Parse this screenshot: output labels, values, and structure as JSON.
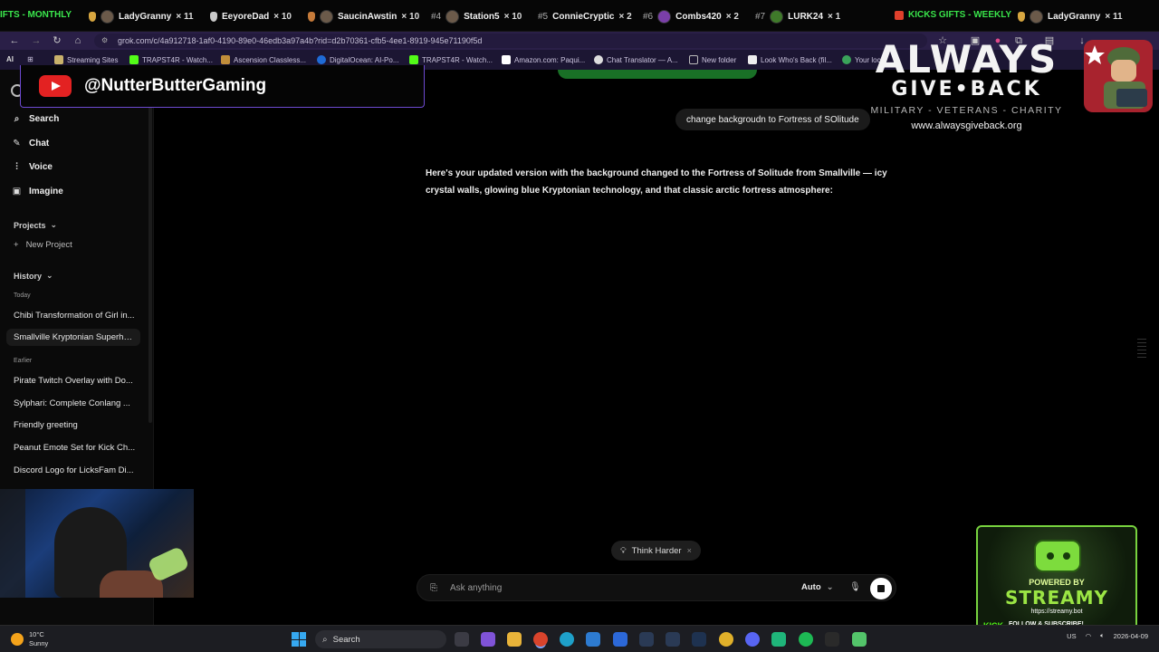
{
  "ticker": {
    "monthly_label": "IFTS - MONTHLY",
    "weekly_label": "KICKS GIFTS - WEEKLY",
    "items": [
      {
        "rank": "",
        "name": "LadyGranny",
        "count": "× 11"
      },
      {
        "rank": "",
        "name": "EeyoreDad",
        "count": "× 10"
      },
      {
        "rank": "",
        "name": "SaucinAwstin",
        "count": "× 10"
      },
      {
        "rank": "#4",
        "name": "Station5",
        "count": "× 10"
      },
      {
        "rank": "#5",
        "name": "ConnieCryptic",
        "count": "× 2"
      },
      {
        "rank": "#6",
        "name": "Combs420",
        "count": "× 2"
      },
      {
        "rank": "#7",
        "name": "LURK24",
        "count": "× 1"
      },
      {
        "rank": "",
        "name": "LadyGranny",
        "count": "× 11"
      }
    ]
  },
  "browser": {
    "url": "grok.com/c/4a912718-1af0-4190-89e0-46edb3a97a4b?rid=d2b70361-cfb5-4ee1-8919-945e71190f5d",
    "bookmarks": [
      "Streaming Sites",
      "TRAPST4R - Watch...",
      "Ascension Classless...",
      "DigitalOcean: AI-Po...",
      "TRAPST4R - Watch...",
      "Amazon.com: Paqui...",
      "Chat Translator — A...",
      "New folder",
      "Look Who's Back (fil...",
      "Your local"
    ]
  },
  "youtube": {
    "handle": "@NutterButterGaming"
  },
  "sidebar": {
    "nav": [
      {
        "label": "Search",
        "icon": "search-icon"
      },
      {
        "label": "Chat",
        "icon": "chat-icon"
      },
      {
        "label": "Voice",
        "icon": "voice-icon"
      },
      {
        "label": "Imagine",
        "icon": "image-icon"
      }
    ],
    "projects_label": "Projects",
    "new_project": "New Project",
    "history_label": "History",
    "today_label": "Today",
    "earlier_label": "Earlier",
    "today_items": [
      "Chibi Transformation of Girl in...",
      "Smallville Kryptonian Superhe..."
    ],
    "earlier_items": [
      "Pirate Twitch Overlay with Do...",
      "Sylphari: Complete Conlang ...",
      "Friendly greeting",
      "Peanut Emote Set for Kick Ch...",
      "Discord Logo for LicksFam Di..."
    ]
  },
  "chat": {
    "user_message": "change backgroudn to Fortress of SOlitude",
    "assistant_message": "Here's your updated version with the background changed to the Fortress of Solitude from Smallville — icy crystal walls, glowing blue Kryptonian technology, and that classic arctic fortress atmosphere:",
    "think_harder": "Think Harder",
    "input_placeholder": "Ask anything",
    "mode": "Auto"
  },
  "overlay": {
    "line1": "ALWAYS",
    "line2": "GIVE•BACK",
    "line3": "MILITARY - VETERANS - CHARITY",
    "line4": "www.alwaysgiveback.org"
  },
  "streamy": {
    "powered": "POWERED BY",
    "name": "STREAMY",
    "url": "https://streamy.bot",
    "kick": "KICK",
    "follow": "FOLLOW & SUBSCRIBE!"
  },
  "taskbar": {
    "temp": "10°C",
    "condition": "Sunny",
    "search": "Search",
    "lang": "US",
    "date": "2026-04-09"
  }
}
